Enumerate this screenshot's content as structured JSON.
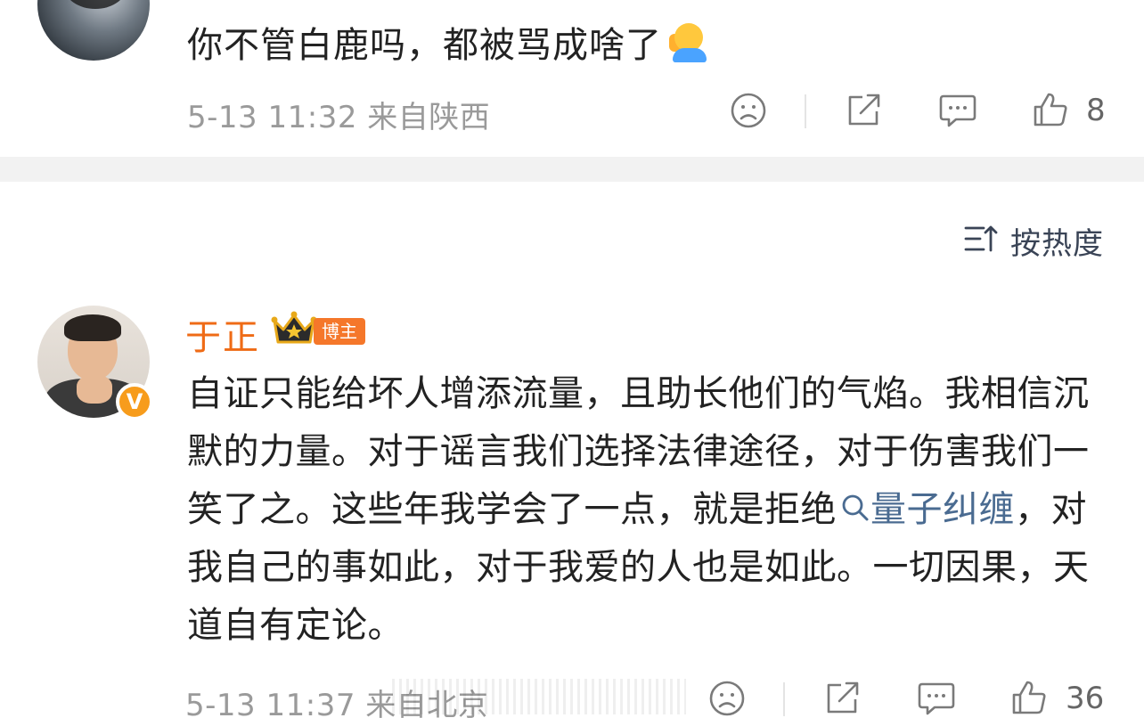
{
  "comment1": {
    "text": "你不管白鹿吗，都被骂成啥了",
    "emoji": "person-saluting-emoji",
    "meta": "5-13 11:32 来自陕西",
    "like_count": "8"
  },
  "sort": {
    "label": "按热度"
  },
  "comment2": {
    "username": "于正",
    "badge": "博主",
    "verified_mark": "V",
    "text_part1": "自证只能给坏人增添流量，且助长他们的气焰。我相信沉默的力量。对于谣言我们选择法律途径，对于伤害我们一笑了之。这些年我学会了一点，就是拒绝",
    "link_text": "量子纠缠",
    "text_part2": "，对我自己的事如此，对于我爱的人也是如此。一切因果，天道自有定论。",
    "meta": "5-13 11:37 来自北京",
    "like_count": "36"
  },
  "colors": {
    "username": "#ef6b16",
    "badge": "#f5772a",
    "link": "#4a6b91",
    "meta": "#9a9a9a",
    "divider_band": "#f2f2f2"
  },
  "icons": [
    "dislike-face-icon",
    "share-icon",
    "comment-icon",
    "like-thumb-icon",
    "sort-icon",
    "search-icon",
    "crown-icon"
  ]
}
